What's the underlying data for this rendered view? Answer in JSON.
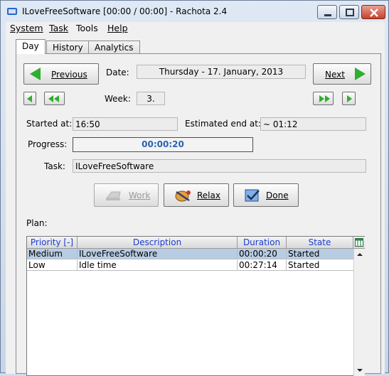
{
  "window": {
    "title": "ILoveFreeSoftware [00:00 / 00:00] - Rachota 2.4"
  },
  "menu": [
    {
      "label": "System",
      "key": "S"
    },
    {
      "label": "Task",
      "key": "T"
    },
    {
      "label": "Tools",
      "key": "o"
    },
    {
      "label": "Help",
      "key": "H"
    }
  ],
  "tabs": {
    "day": "Day",
    "history": "History",
    "analytics": "Analytics"
  },
  "nav": {
    "previous_label": "Previous",
    "next_label": "Next",
    "date_label": "Date:",
    "date_value": "Thursday - 17. January, 2013",
    "week_label": "Week:",
    "week_value": "3."
  },
  "task": {
    "started_label": "Started at:",
    "started_value": "16:50",
    "estimated_label": "Estimated end at:",
    "estimated_value": "~ 01:12",
    "progress_label": "Progress:",
    "progress_value": "00:00:20",
    "task_label": "Task:",
    "task_value": "ILoveFreeSoftware"
  },
  "actions": {
    "work": "Work",
    "relax": "Relax",
    "done": "Done"
  },
  "plan": {
    "label": "Plan:",
    "headers": {
      "priority": "Priority [-]",
      "description": "Description",
      "duration": "Duration",
      "state": "State"
    },
    "rows": [
      {
        "priority": "Medium",
        "description": "ILoveFreeSoftware",
        "duration": "00:00:20",
        "state": "Started"
      },
      {
        "priority": "Low",
        "description": "Idle time",
        "duration": "00:27:14",
        "state": "Started"
      }
    ]
  },
  "colors": {
    "accent_green": "#2fae2f",
    "selection": "#b8cde4",
    "header_text": "#1a3bd3"
  }
}
